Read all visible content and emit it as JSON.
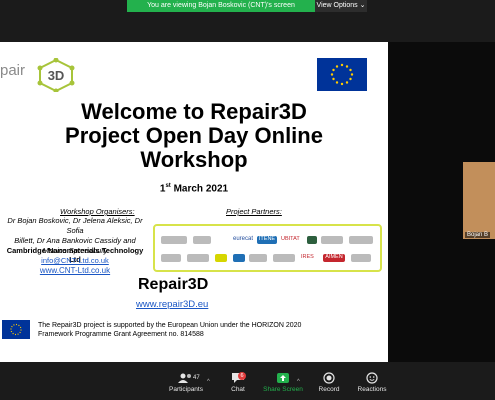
{
  "banner": {
    "viewing_text": "You are viewing Bojan Boskovic (CNT)'s screen",
    "view_options": "View Options ⌄"
  },
  "slide": {
    "logo_prefix": "pair",
    "logo_3d": "3D",
    "title_line1": "Welcome to Repair3D",
    "title_line2": "Project Open Day Online",
    "title_line3": "Workshop",
    "date_day": "1",
    "date_suffix": "st",
    "date_rest": " March 2021",
    "organisers_label": "Workshop Organisers:",
    "organisers_line1": "Dr Bojan Boskovic, Dr Jelena Aleksic, Dr Sofia",
    "organisers_line2": "Billett, Dr Ana Bankovic Cassidy and",
    "organisers_line3": "Monica Spreadbury",
    "company": "Cambridge Nanomaterials Technology Ltd",
    "email": "info@CNT-Ltd.co.uk",
    "website": "www.CNT-Ltd.co.uk",
    "partners_label": "Project Partners:",
    "partners": [
      "eurecat",
      "ITENE",
      "UBITAT",
      "ITENE",
      "IRES",
      "AIMEN"
    ],
    "brand": "Repair3D",
    "brand_url": "www.repair3D.eu",
    "funding_line1": "The Repair3D  project is supported by the European Union under the HORIZON 2020",
    "funding_line2": "Framework Programme Grant Agreement no. 814588"
  },
  "participant": {
    "name": "Bojan B"
  },
  "toolbar": {
    "participants_count": "47",
    "participants_label": "Participants",
    "chat_label": "Chat",
    "chat_badge": "6",
    "share_label": "Share Screen",
    "record_label": "Record",
    "reactions_label": "Reactions"
  },
  "colors": {
    "banner_green": "#23b14d",
    "link_blue": "#1a56c4",
    "eu_blue": "#003399",
    "partner_border": "#d7e34a"
  }
}
